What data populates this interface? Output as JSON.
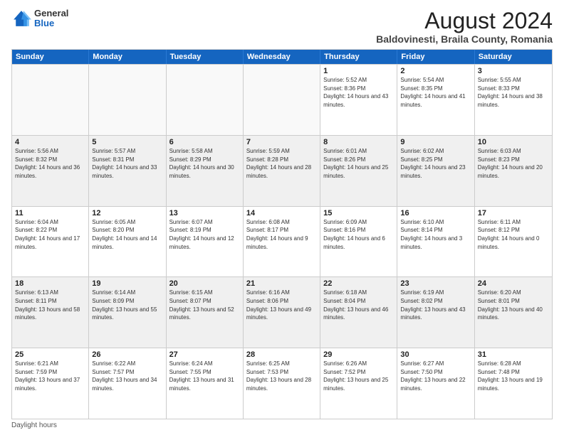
{
  "logo": {
    "general": "General",
    "blue": "Blue"
  },
  "title": "August 2024",
  "subtitle": "Baldovinesti, Braila County, Romania",
  "days": [
    "Sunday",
    "Monday",
    "Tuesday",
    "Wednesday",
    "Thursday",
    "Friday",
    "Saturday"
  ],
  "weeks": [
    [
      {
        "day": "",
        "info": ""
      },
      {
        "day": "",
        "info": ""
      },
      {
        "day": "",
        "info": ""
      },
      {
        "day": "",
        "info": ""
      },
      {
        "day": "1",
        "info": "Sunrise: 5:52 AM\nSunset: 8:36 PM\nDaylight: 14 hours and 43 minutes."
      },
      {
        "day": "2",
        "info": "Sunrise: 5:54 AM\nSunset: 8:35 PM\nDaylight: 14 hours and 41 minutes."
      },
      {
        "day": "3",
        "info": "Sunrise: 5:55 AM\nSunset: 8:33 PM\nDaylight: 14 hours and 38 minutes."
      }
    ],
    [
      {
        "day": "4",
        "info": "Sunrise: 5:56 AM\nSunset: 8:32 PM\nDaylight: 14 hours and 36 minutes."
      },
      {
        "day": "5",
        "info": "Sunrise: 5:57 AM\nSunset: 8:31 PM\nDaylight: 14 hours and 33 minutes."
      },
      {
        "day": "6",
        "info": "Sunrise: 5:58 AM\nSunset: 8:29 PM\nDaylight: 14 hours and 30 minutes."
      },
      {
        "day": "7",
        "info": "Sunrise: 5:59 AM\nSunset: 8:28 PM\nDaylight: 14 hours and 28 minutes."
      },
      {
        "day": "8",
        "info": "Sunrise: 6:01 AM\nSunset: 8:26 PM\nDaylight: 14 hours and 25 minutes."
      },
      {
        "day": "9",
        "info": "Sunrise: 6:02 AM\nSunset: 8:25 PM\nDaylight: 14 hours and 23 minutes."
      },
      {
        "day": "10",
        "info": "Sunrise: 6:03 AM\nSunset: 8:23 PM\nDaylight: 14 hours and 20 minutes."
      }
    ],
    [
      {
        "day": "11",
        "info": "Sunrise: 6:04 AM\nSunset: 8:22 PM\nDaylight: 14 hours and 17 minutes."
      },
      {
        "day": "12",
        "info": "Sunrise: 6:05 AM\nSunset: 8:20 PM\nDaylight: 14 hours and 14 minutes."
      },
      {
        "day": "13",
        "info": "Sunrise: 6:07 AM\nSunset: 8:19 PM\nDaylight: 14 hours and 12 minutes."
      },
      {
        "day": "14",
        "info": "Sunrise: 6:08 AM\nSunset: 8:17 PM\nDaylight: 14 hours and 9 minutes."
      },
      {
        "day": "15",
        "info": "Sunrise: 6:09 AM\nSunset: 8:16 PM\nDaylight: 14 hours and 6 minutes."
      },
      {
        "day": "16",
        "info": "Sunrise: 6:10 AM\nSunset: 8:14 PM\nDaylight: 14 hours and 3 minutes."
      },
      {
        "day": "17",
        "info": "Sunrise: 6:11 AM\nSunset: 8:12 PM\nDaylight: 14 hours and 0 minutes."
      }
    ],
    [
      {
        "day": "18",
        "info": "Sunrise: 6:13 AM\nSunset: 8:11 PM\nDaylight: 13 hours and 58 minutes."
      },
      {
        "day": "19",
        "info": "Sunrise: 6:14 AM\nSunset: 8:09 PM\nDaylight: 13 hours and 55 minutes."
      },
      {
        "day": "20",
        "info": "Sunrise: 6:15 AM\nSunset: 8:07 PM\nDaylight: 13 hours and 52 minutes."
      },
      {
        "day": "21",
        "info": "Sunrise: 6:16 AM\nSunset: 8:06 PM\nDaylight: 13 hours and 49 minutes."
      },
      {
        "day": "22",
        "info": "Sunrise: 6:18 AM\nSunset: 8:04 PM\nDaylight: 13 hours and 46 minutes."
      },
      {
        "day": "23",
        "info": "Sunrise: 6:19 AM\nSunset: 8:02 PM\nDaylight: 13 hours and 43 minutes."
      },
      {
        "day": "24",
        "info": "Sunrise: 6:20 AM\nSunset: 8:01 PM\nDaylight: 13 hours and 40 minutes."
      }
    ],
    [
      {
        "day": "25",
        "info": "Sunrise: 6:21 AM\nSunset: 7:59 PM\nDaylight: 13 hours and 37 minutes."
      },
      {
        "day": "26",
        "info": "Sunrise: 6:22 AM\nSunset: 7:57 PM\nDaylight: 13 hours and 34 minutes."
      },
      {
        "day": "27",
        "info": "Sunrise: 6:24 AM\nSunset: 7:55 PM\nDaylight: 13 hours and 31 minutes."
      },
      {
        "day": "28",
        "info": "Sunrise: 6:25 AM\nSunset: 7:53 PM\nDaylight: 13 hours and 28 minutes."
      },
      {
        "day": "29",
        "info": "Sunrise: 6:26 AM\nSunset: 7:52 PM\nDaylight: 13 hours and 25 minutes."
      },
      {
        "day": "30",
        "info": "Sunrise: 6:27 AM\nSunset: 7:50 PM\nDaylight: 13 hours and 22 minutes."
      },
      {
        "day": "31",
        "info": "Sunrise: 6:28 AM\nSunset: 7:48 PM\nDaylight: 13 hours and 19 minutes."
      }
    ]
  ],
  "footer": "Daylight hours"
}
